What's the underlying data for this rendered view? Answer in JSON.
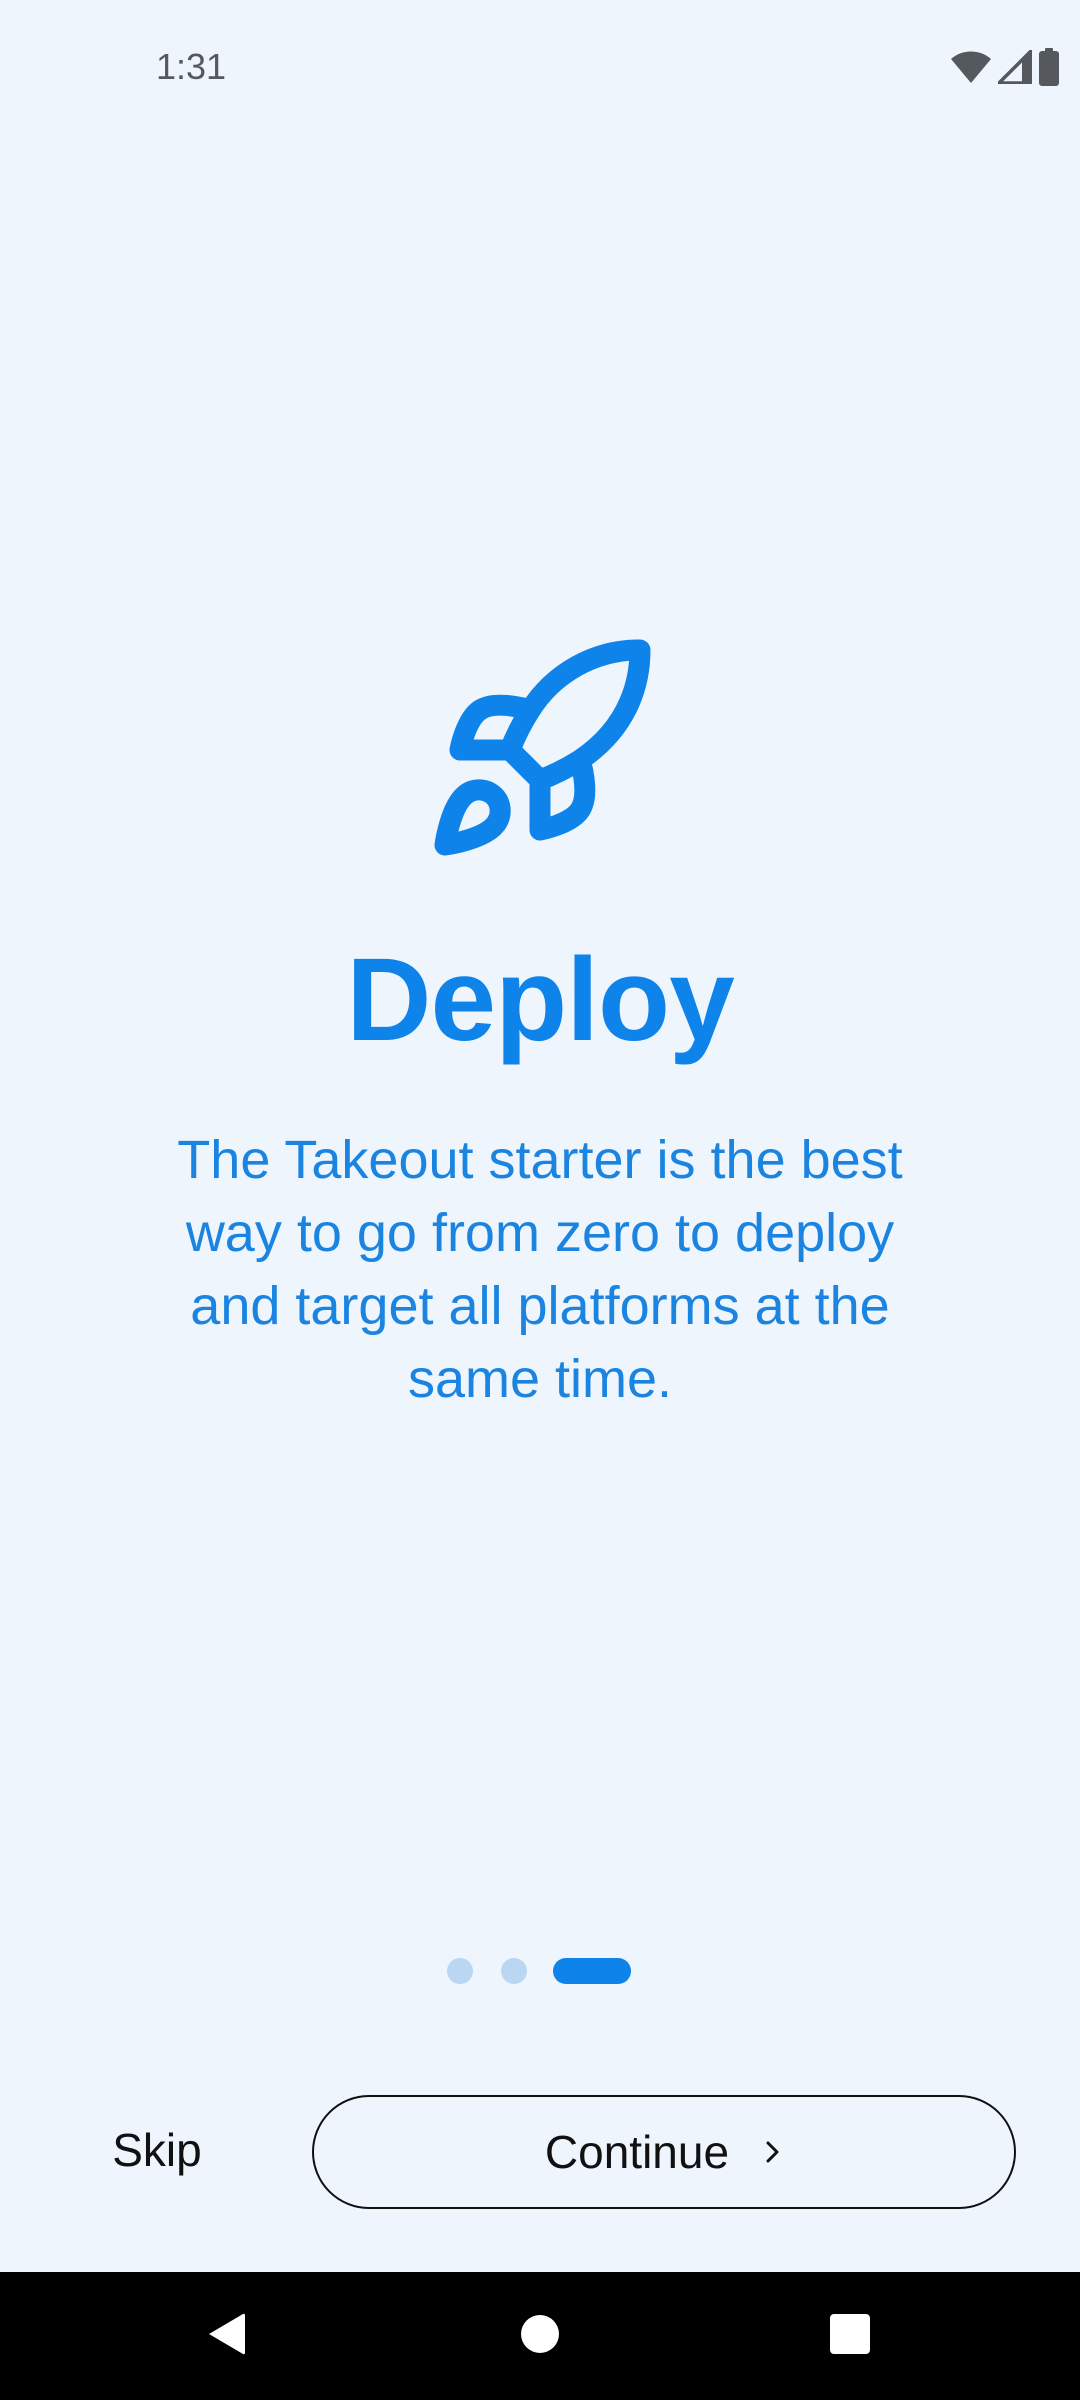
{
  "status_bar": {
    "time": "1:31",
    "icons": [
      "wifi-icon",
      "signal-icon",
      "battery-icon"
    ]
  },
  "hero": {
    "icon": "rocket-icon",
    "title": "Deploy",
    "description": "The Takeout starter is the best way to go from zero to deploy and target all platforms at the same time."
  },
  "pager": {
    "page_count": 3,
    "active_index": 2
  },
  "actions": {
    "skip_label": "Skip",
    "continue_label": "Continue",
    "continue_icon": "chevron-right-icon"
  },
  "nav_bar": {
    "buttons": [
      "back-icon",
      "home-icon",
      "recents-icon"
    ]
  },
  "colors": {
    "background": "#eef5fd",
    "accent": "#0e83ea",
    "dot_inactive": "#b9d6f2"
  }
}
